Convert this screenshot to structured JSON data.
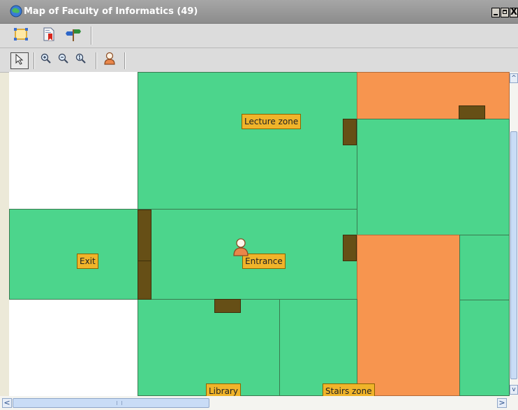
{
  "window": {
    "title": "Map of Faculty of Informatics (49)",
    "controls": {
      "minimize": "_",
      "maximize": "□",
      "close": "X"
    }
  },
  "toolbar_top": {
    "items": [
      {
        "icon": "fit-to-window-icon"
      },
      {
        "icon": "document-bookmark-icon"
      },
      {
        "icon": "signpost-icon"
      }
    ]
  },
  "toolbar_bottom": {
    "items": [
      {
        "icon": "pointer-arrow-icon",
        "selected": true
      },
      {
        "icon": "zoom-in-icon"
      },
      {
        "icon": "zoom-out-icon"
      },
      {
        "icon": "zoom-reset-icon"
      },
      {
        "icon": "person-icon"
      }
    ]
  },
  "map": {
    "zones": [
      {
        "name": "Lecture zone",
        "type": "lecture",
        "color": "#4cd58c"
      },
      {
        "name": "Entrance",
        "type": "entrance",
        "color": "#4cd58c"
      },
      {
        "name": "Exit",
        "type": "exit",
        "color": "#4cd58c"
      },
      {
        "name": "Library",
        "type": "library",
        "color": "#4cd58c"
      },
      {
        "name": "Stairs zone",
        "type": "stairs",
        "color": "#4cd58c"
      }
    ],
    "restricted_color": "#f7954f",
    "door_color": "#664f16",
    "label_color": "#f0b42a",
    "marker": "person-icon"
  },
  "scrollbars": {
    "horizontal": {
      "left_arrow": "<",
      "right_arrow": ">"
    },
    "vertical": {
      "up_arrow": "^",
      "down_arrow": "v"
    }
  }
}
